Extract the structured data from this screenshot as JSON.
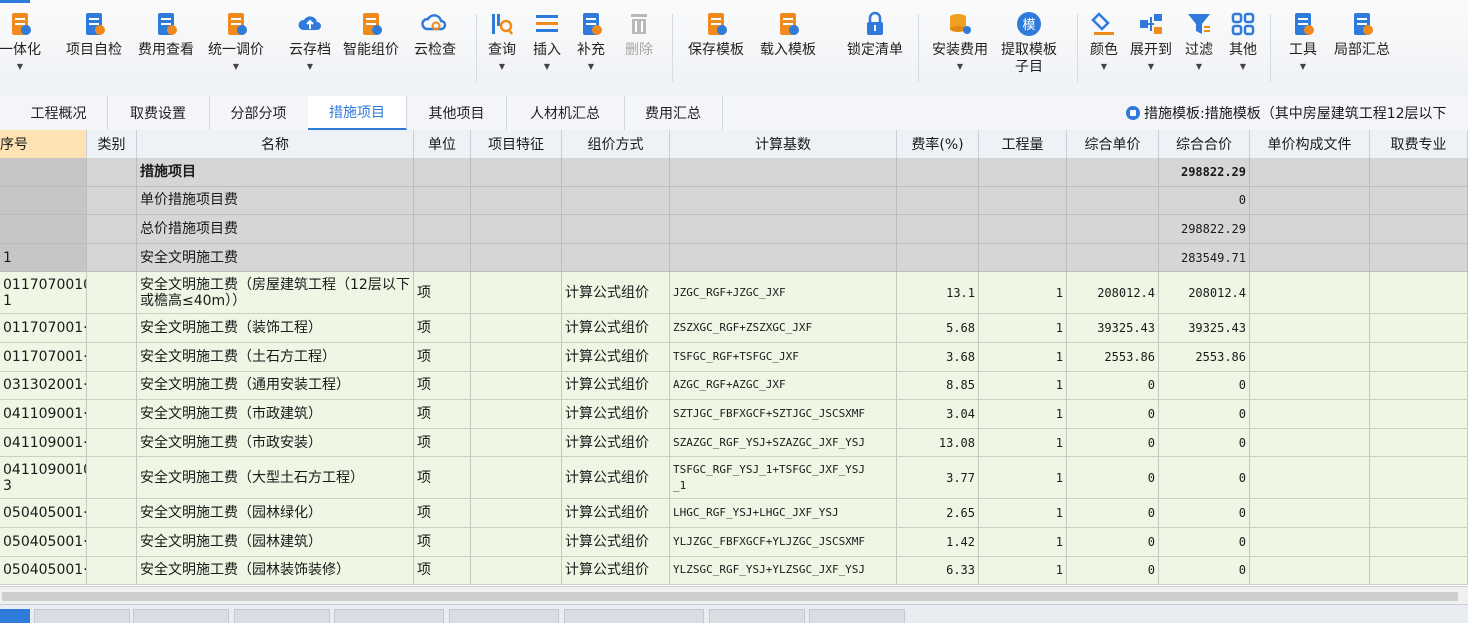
{
  "toolbar": {
    "items": [
      {
        "label": "一体化",
        "icon": "integration-icon",
        "dropdown": true
      },
      {
        "label": "项目自检",
        "icon": "self-check-icon",
        "dropdown": false
      },
      {
        "label": "费用查看",
        "icon": "fee-view-icon",
        "dropdown": false
      },
      {
        "label": "统一调价",
        "icon": "price-adjust-icon",
        "dropdown": true
      },
      {
        "label": "云存档",
        "icon": "cloud-upload-icon",
        "dropdown": true
      },
      {
        "label": "智能组价",
        "icon": "smart-pricing-icon",
        "dropdown": false
      },
      {
        "label": "云检查",
        "icon": "cloud-check-icon",
        "dropdown": false
      },
      {
        "label": "查询",
        "icon": "query-icon",
        "dropdown": true
      },
      {
        "label": "插入",
        "icon": "insert-icon",
        "dropdown": true
      },
      {
        "label": "补充",
        "icon": "supplement-icon",
        "dropdown": true
      },
      {
        "label": "删除",
        "icon": "trash-icon",
        "dropdown": false,
        "disabled": true
      },
      {
        "label": "保存模板",
        "icon": "save-template-icon",
        "dropdown": false
      },
      {
        "label": "载入模板",
        "icon": "load-template-icon",
        "dropdown": false
      },
      {
        "label": "锁定清单",
        "icon": "lock-icon",
        "dropdown": false
      },
      {
        "label": "安装费用",
        "icon": "install-fee-icon",
        "dropdown": true
      },
      {
        "label": "提取模板",
        "label2": "子目",
        "icon": "extract-template-icon",
        "dropdown": false
      },
      {
        "label": "颜色",
        "icon": "color-icon",
        "dropdown": true
      },
      {
        "label": "展开到",
        "icon": "expand-to-icon",
        "dropdown": true
      },
      {
        "label": "过滤",
        "icon": "filter-icon",
        "dropdown": true
      },
      {
        "label": "其他",
        "icon": "other-icon",
        "dropdown": true
      },
      {
        "label": "工具",
        "icon": "tools-icon",
        "dropdown": true
      },
      {
        "label": "局部汇总",
        "icon": "partial-summary-icon",
        "dropdown": false
      }
    ]
  },
  "tabs": [
    {
      "label": "工程概况",
      "active": false
    },
    {
      "label": "取费设置",
      "active": false
    },
    {
      "label": "分部分项",
      "active": false
    },
    {
      "label": "措施项目",
      "active": true
    },
    {
      "label": "其他项目",
      "active": false
    },
    {
      "label": "人材机汇总",
      "active": false
    },
    {
      "label": "费用汇总",
      "active": false
    }
  ],
  "template_info": "措施模板:措施模板（其中房屋建筑工程12层以下",
  "table": {
    "columns": [
      "序号",
      "类别",
      "名称",
      "单位",
      "项目特征",
      "组价方式",
      "计算基数",
      "费率(%)",
      "工程量",
      "综合单价",
      "综合合价",
      "单价构成文件",
      "取费专业"
    ],
    "rows": [
      {
        "style": "grey",
        "code": "",
        "name": "措施项目",
        "unit": "",
        "method": "",
        "base": "",
        "rate": "",
        "qty": "",
        "unit_price": "",
        "total": "298822.29",
        "bold": true
      },
      {
        "style": "grey",
        "code": "",
        "name": "单价措施项目费",
        "unit": "",
        "method": "",
        "base": "",
        "rate": "",
        "qty": "",
        "unit_price": "",
        "total": "0"
      },
      {
        "style": "grey",
        "code": "",
        "name": "总价措施项目费",
        "unit": "",
        "method": "",
        "base": "",
        "rate": "",
        "qty": "",
        "unit_price": "",
        "total": "298822.29"
      },
      {
        "style": "grey",
        "code": "1",
        "name": "安全文明施工费",
        "unit": "",
        "method": "",
        "base": "",
        "rate": "",
        "qty": "",
        "unit_price": "",
        "total": "283549.71"
      },
      {
        "style": "green",
        "code": "01170700100\n1",
        "name": "安全文明施工费（房屋建筑工程（12层以下或檐高≤40m））",
        "unit": "项",
        "method": "计算公式组价",
        "base": "JZGC_RGF+JZGC_JXF",
        "rate": "13.1",
        "qty": "1",
        "unit_price": "208012.4",
        "total": "208012.4",
        "tall": true
      },
      {
        "style": "green",
        "code": "011707001···",
        "name": "安全文明施工费（装饰工程）",
        "unit": "项",
        "method": "计算公式组价",
        "base": "ZSZXGC_RGF+ZSZXGC_JXF",
        "rate": "5.68",
        "qty": "1",
        "unit_price": "39325.43",
        "total": "39325.43"
      },
      {
        "style": "green",
        "code": "011707001···",
        "name": "安全文明施工费（土石方工程）",
        "unit": "项",
        "method": "计算公式组价",
        "base": "TSFGC_RGF+TSFGC_JXF",
        "rate": "3.68",
        "qty": "1",
        "unit_price": "2553.86",
        "total": "2553.86"
      },
      {
        "style": "green",
        "code": "031302001···",
        "name": "安全文明施工费（通用安装工程）",
        "unit": "项",
        "method": "计算公式组价",
        "base": "AZGC_RGF+AZGC_JXF",
        "rate": "8.85",
        "qty": "1",
        "unit_price": "0",
        "total": "0"
      },
      {
        "style": "green",
        "code": "041109001···",
        "name": "安全文明施工费（市政建筑）",
        "unit": "项",
        "method": "计算公式组价",
        "base": "SZTJGC_FBFXGCF+SZTJGC_JSCSXMF",
        "rate": "3.04",
        "qty": "1",
        "unit_price": "0",
        "total": "0"
      },
      {
        "style": "green",
        "code": "041109001···",
        "name": "安全文明施工费（市政安装）",
        "unit": "项",
        "method": "计算公式组价",
        "base": "SZAZGC_RGF_YSJ+SZAZGC_JXF_YSJ",
        "rate": "13.08",
        "qty": "1",
        "unit_price": "0",
        "total": "0"
      },
      {
        "style": "green",
        "code": "04110900100\n3",
        "name": "安全文明施工费（大型土石方工程）",
        "unit": "项",
        "method": "计算公式组价",
        "base": "TSFGC_RGF_YSJ_1+TSFGC_JXF_YSJ\n_1",
        "rate": "3.77",
        "qty": "1",
        "unit_price": "0",
        "total": "0",
        "tall": true
      },
      {
        "style": "green",
        "code": "050405001···",
        "name": "安全文明施工费（园林绿化）",
        "unit": "项",
        "method": "计算公式组价",
        "base": "LHGC_RGF_YSJ+LHGC_JXF_YSJ",
        "rate": "2.65",
        "qty": "1",
        "unit_price": "0",
        "total": "0"
      },
      {
        "style": "green",
        "code": "050405001···",
        "name": "安全文明施工费（园林建筑）",
        "unit": "项",
        "method": "计算公式组价",
        "base": "YLJZGC_FBFXGCF+YLJZGC_JSCSXMF",
        "rate": "1.42",
        "qty": "1",
        "unit_price": "0",
        "total": "0"
      },
      {
        "style": "green",
        "code": "050405001···",
        "name": "安全文明施工费（园林装饰装修）",
        "unit": "项",
        "method": "计算公式组价",
        "base": "YLZSGC_RGF_YSJ+YLZSGC_JXF_YSJ",
        "rate": "6.33",
        "qty": "1",
        "unit_price": "0",
        "total": "0"
      }
    ]
  },
  "colors": {
    "accent": "#2f7bdc",
    "grey_row": "#d6d6d6",
    "green_row": "#eef7e4",
    "header_sel": "#fde3b4"
  }
}
